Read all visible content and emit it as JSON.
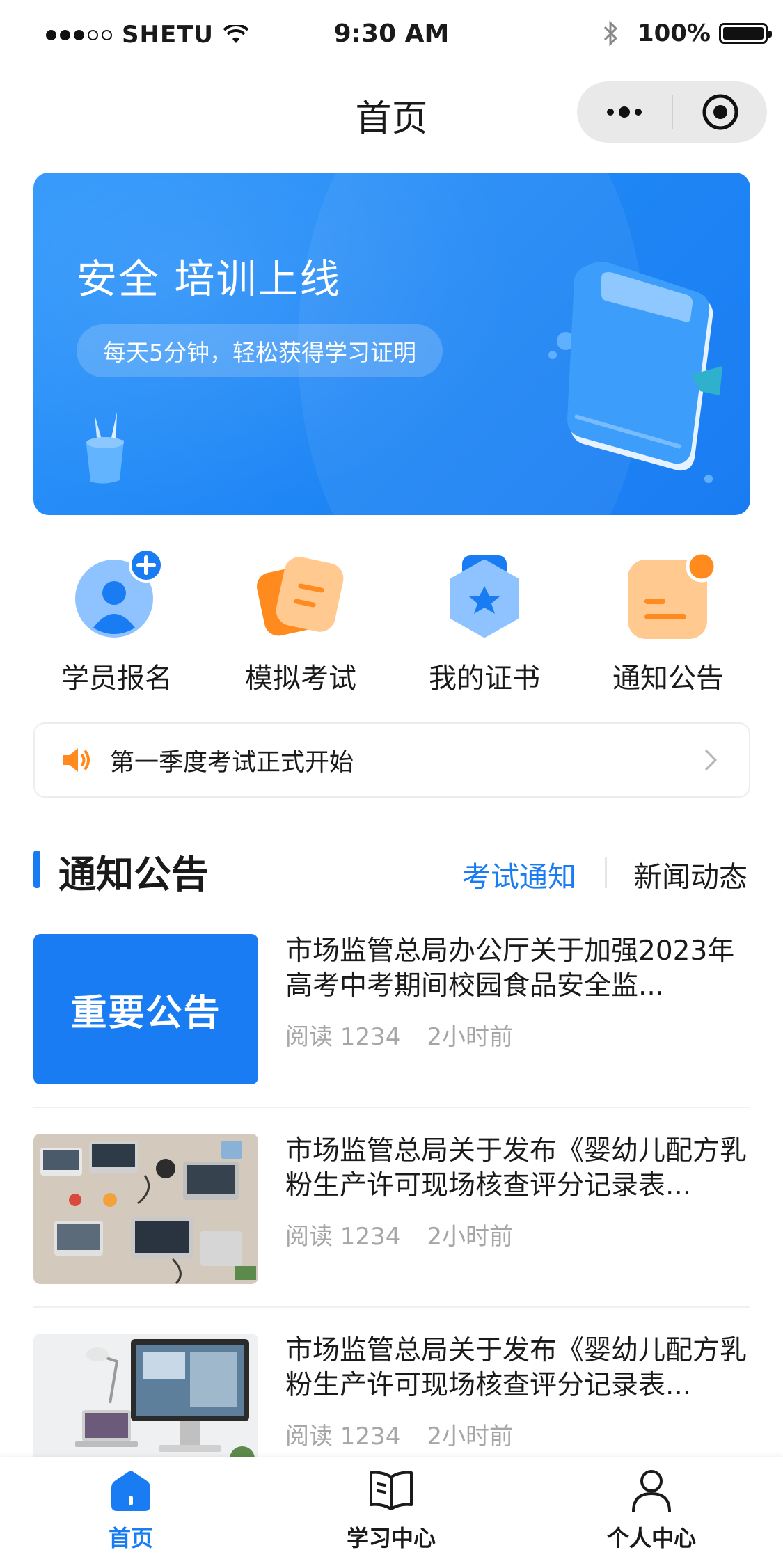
{
  "status_bar": {
    "carrier": "SHETU",
    "time": "9:30 AM",
    "battery": "100%"
  },
  "nav": {
    "title": "首页"
  },
  "banner": {
    "title": "安全 培训上线",
    "subtitle": "每天5分钟，轻松获得学习证明"
  },
  "quick_entries": [
    {
      "label": "学员报名",
      "icon": "user-add-icon"
    },
    {
      "label": "模拟考试",
      "icon": "exam-icon"
    },
    {
      "label": "我的证书",
      "icon": "certificate-icon"
    },
    {
      "label": "通知公告",
      "icon": "notice-icon"
    }
  ],
  "notice_bar": {
    "text": "第一季度考试正式开始",
    "icon": "speaker-icon"
  },
  "section": {
    "title": "通知公告",
    "tabs": [
      "考试通知",
      "新闻动态"
    ],
    "active_tab": "考试通知"
  },
  "news": [
    {
      "thumb_text": "重要公告",
      "title": "市场监管总局办公厅关于加强2023年高考中考期间校园食品安全监...",
      "reads": "阅读 1234",
      "time": "2小时前"
    },
    {
      "title": "市场监管总局关于发布《婴幼儿配方乳粉生产许可现场核查评分记录表...",
      "reads": "阅读 1234",
      "time": "2小时前"
    },
    {
      "title": "市场监管总局关于发布《婴幼儿配方乳粉生产许可现场核查评分记录表...",
      "reads": "阅读 1234",
      "time": "2小时前"
    }
  ],
  "tabbar": {
    "items": [
      {
        "label": "首页",
        "icon": "home-icon"
      },
      {
        "label": "学习中心",
        "icon": "book-icon"
      },
      {
        "label": "个人中心",
        "icon": "person-icon"
      }
    ],
    "active": "首页"
  },
  "colors": {
    "primary": "#1a7cf2",
    "orange": "#ff8a1e"
  }
}
